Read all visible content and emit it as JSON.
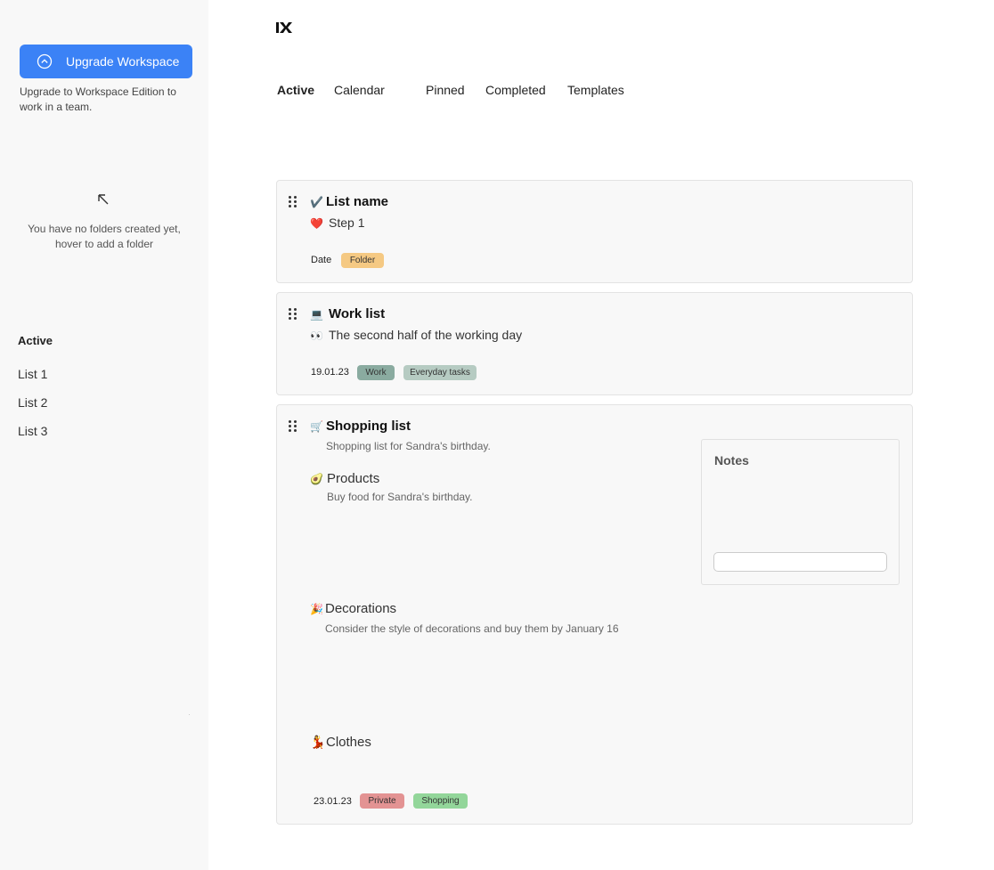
{
  "sidebar": {
    "upgrade_button": "Upgrade Workspace",
    "upgrade_note": "Upgrade to Workspace Edition to work in a team.",
    "folders_empty_note": "You have no folders created yet, hover to add a folder",
    "section_heading": "Active",
    "lists": [
      {
        "label": "List 1"
      },
      {
        "label": "List 2"
      },
      {
        "label": "List 3"
      }
    ]
  },
  "tabs": [
    {
      "label": "Active",
      "active": true
    },
    {
      "label": "Calendar"
    },
    {
      "label": "Pinned"
    },
    {
      "label": "Completed"
    },
    {
      "label": "Templates"
    }
  ],
  "cards": [
    {
      "emoji": "✔️",
      "title": "List name",
      "step_emoji": "❤️",
      "step": "Step 1",
      "date": "Date",
      "tags": [
        {
          "label": "Folder",
          "color": "#f5c983"
        }
      ]
    },
    {
      "emoji": "💻",
      "title": "Work list",
      "step_emoji": "👀",
      "step": "The second half of the working day",
      "date": "19.01.23",
      "tags": [
        {
          "label": "Work",
          "color": "#8aaba0"
        },
        {
          "label": "Everyday tasks",
          "color": "#b6cbc2"
        }
      ]
    },
    {
      "emoji": "🛒",
      "title": "Shopping list",
      "description": "Shopping list for Sandra's birthday.",
      "items": [
        {
          "emoji": "🥑",
          "title": "Products",
          "description": "Buy food for Sandra's birthday."
        },
        {
          "emoji": "🎉",
          "title": "Decorations",
          "description": "Consider the style of decorations and buy them by January 16"
        },
        {
          "emoji": "💃",
          "title": "Clothes"
        }
      ],
      "date": "23.01.23",
      "tags": [
        {
          "label": "Private",
          "color": "#e39393"
        },
        {
          "label": "Shopping",
          "color": "#93d69a"
        }
      ],
      "notes": {
        "title": "Notes",
        "placeholder": ""
      }
    }
  ],
  "colors": {
    "accent": "#3b82f6",
    "sidebar_bg": "#f8f8f8",
    "card_bg": "#f8f8f8"
  }
}
